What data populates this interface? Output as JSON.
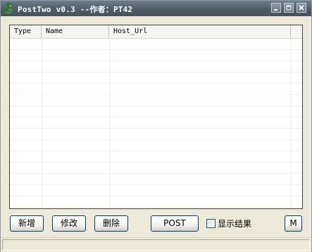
{
  "window": {
    "title": "PostTwo v0.3 --作者：PT42"
  },
  "icons": {
    "app": "snake-icon",
    "minimize": "minimize-icon",
    "maximize": "maximize-icon",
    "close": "close-icon"
  },
  "list": {
    "columns": [
      "Type",
      "Name",
      "Host_Url"
    ],
    "rows": []
  },
  "buttons": {
    "add": "新增",
    "edit": "修改",
    "delete": "删除",
    "post": "POST",
    "m": "M"
  },
  "options": {
    "show_results_label": "显示结果",
    "show_results_checked": false
  },
  "status": {
    "text": ""
  }
}
